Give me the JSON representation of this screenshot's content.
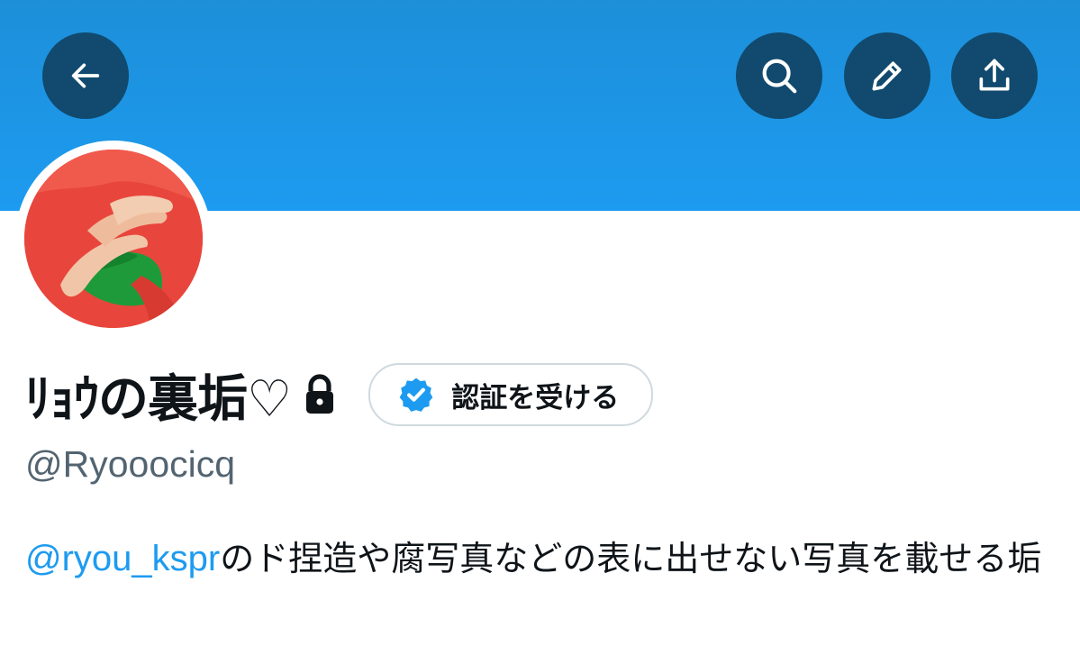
{
  "header": {
    "back_icon": "arrow-left-icon",
    "search_icon": "search-icon",
    "edit_icon": "pencil-icon",
    "share_icon": "share-icon",
    "banner_color": "#1d9bf0",
    "button_color": "#114a6e"
  },
  "profile": {
    "display_name": "ﾘｮｳの裏垢♡",
    "protected_icon": "lock-icon",
    "verify_button_label": "認証を受ける",
    "verify_icon": "verified-badge-icon",
    "handle": "@Ryooocicq",
    "bio": {
      "mention": "@ryou_kspr",
      "text": "のド捏造や腐写真などの表に出せない写真を載せる垢"
    }
  },
  "colors": {
    "accent": "#1d9bf0",
    "text_primary": "#0f1419",
    "text_secondary": "#536471"
  }
}
